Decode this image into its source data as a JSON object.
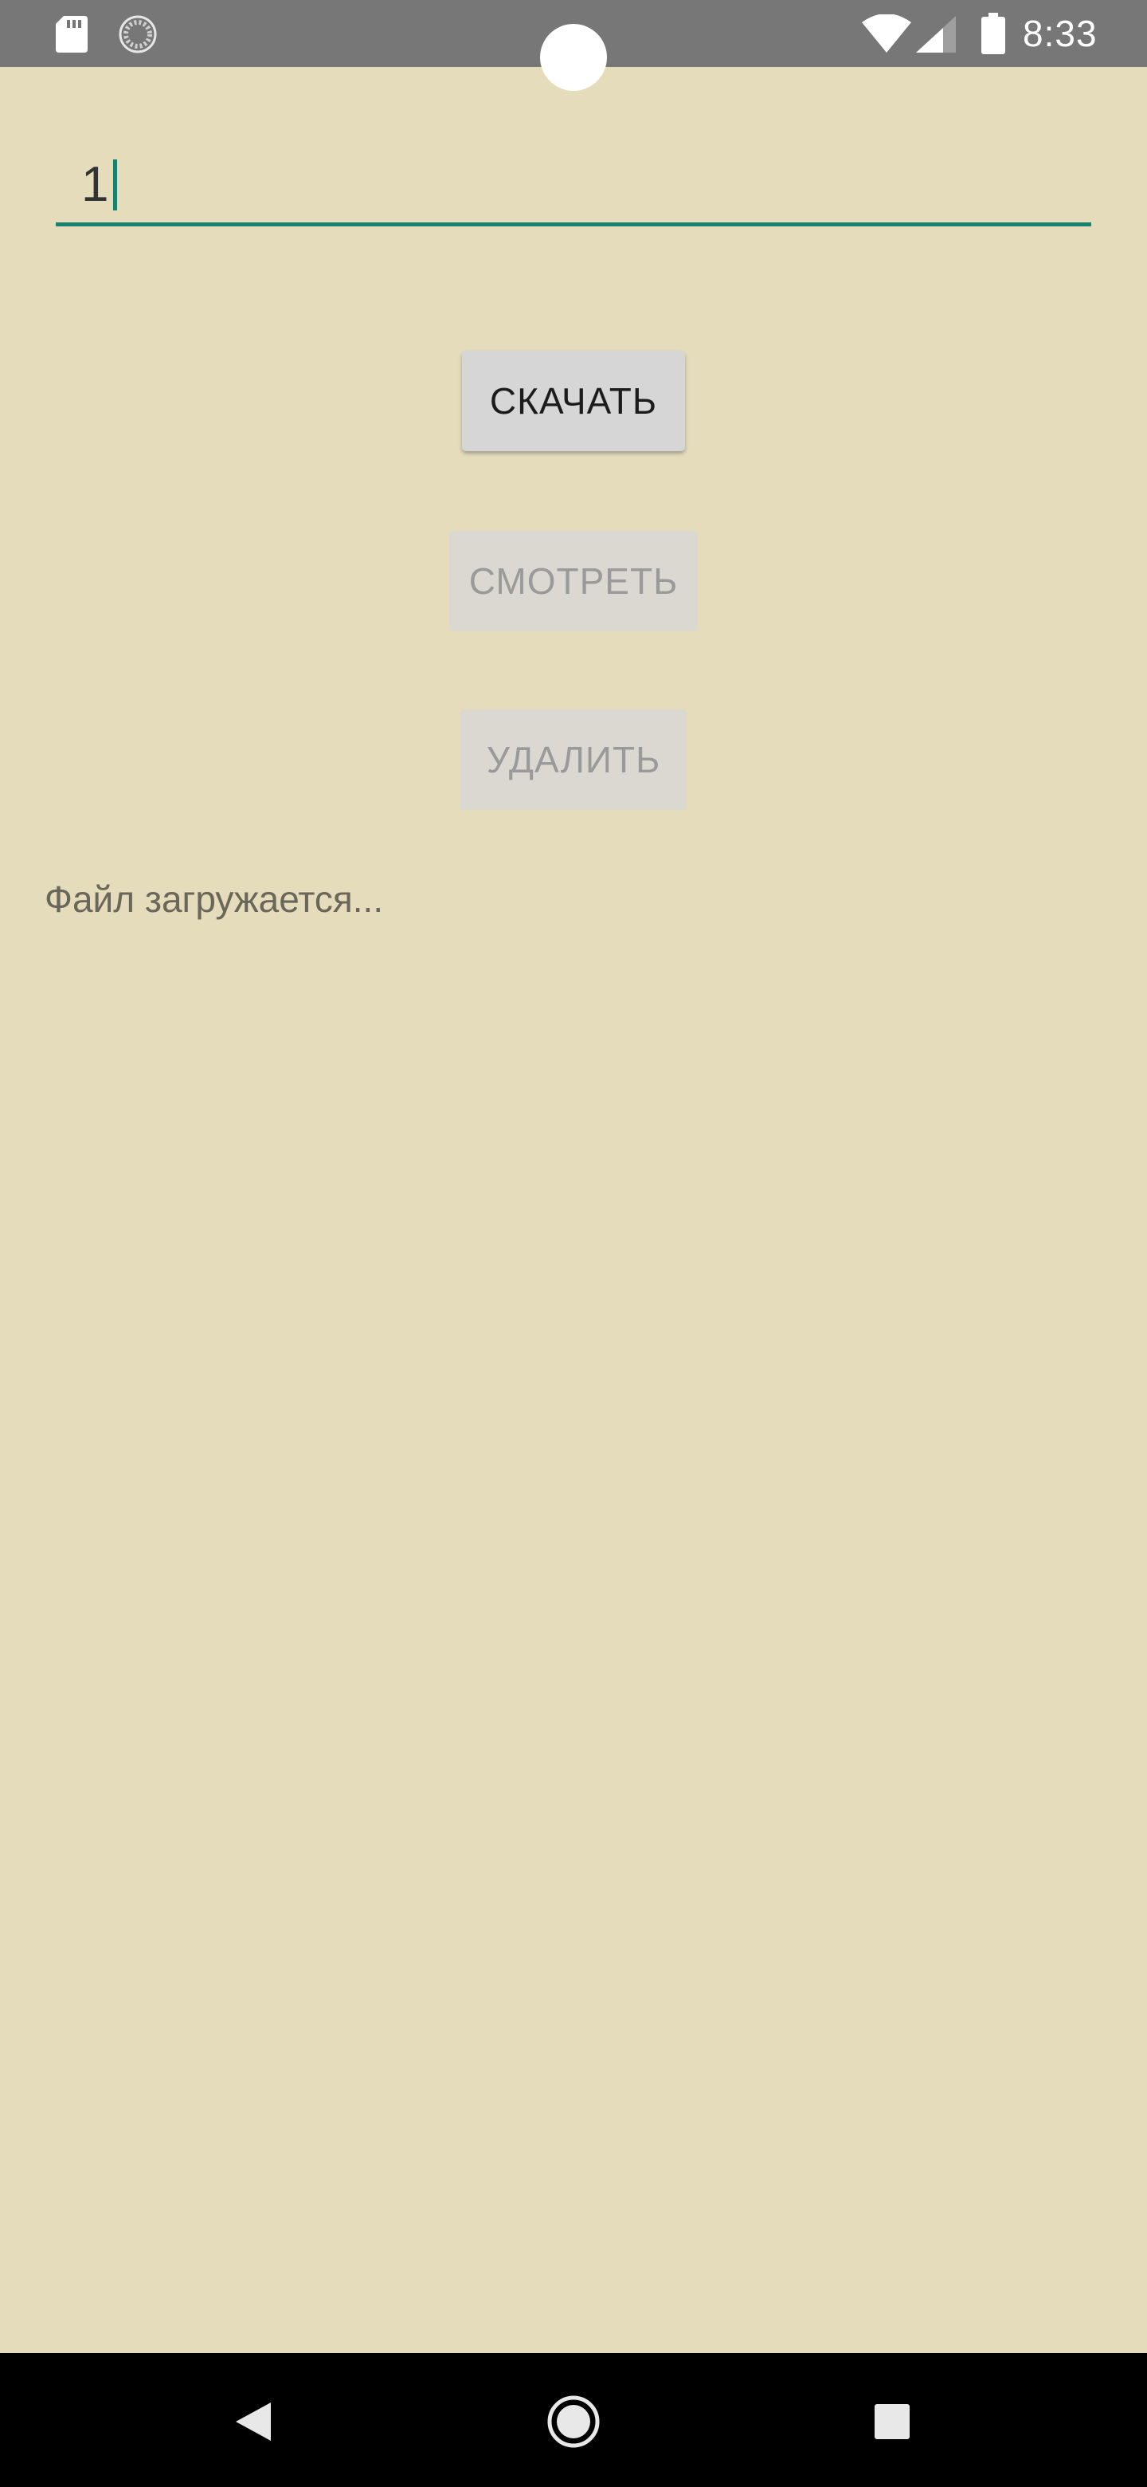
{
  "status_bar": {
    "time": "8:33",
    "icons": [
      "sd-card-icon",
      "sync-icon",
      "wifi-icon",
      "cellular-signal-icon",
      "battery-icon"
    ]
  },
  "input": {
    "value": "1"
  },
  "buttons": {
    "download": "СКАЧАТЬ",
    "view": "СМОТРЕТЬ",
    "delete": "УДАЛИТЬ"
  },
  "status_message": "Файл загружается...",
  "nav_bar": {
    "icons": [
      "back-icon",
      "home-icon",
      "recents-icon"
    ]
  },
  "colors": {
    "background": "#e4dcbb",
    "accent": "#19826f",
    "status_bar": "#777777",
    "nav_bar": "#000000",
    "button_enabled": "#d6d6d6",
    "button_disabled_text": "#9a9a9a"
  }
}
